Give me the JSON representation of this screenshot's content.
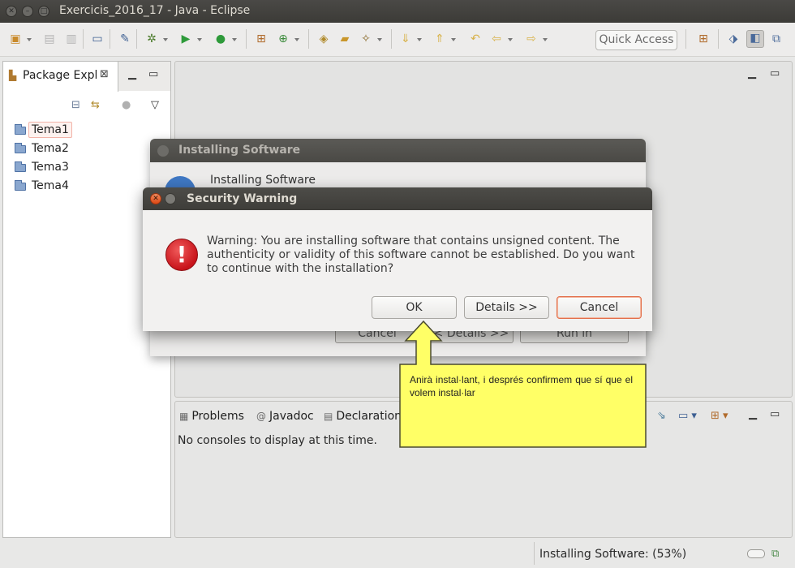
{
  "window": {
    "title": "Exercicis_2016_17 - Java - Eclipse",
    "buttons": [
      "close-icon",
      "minimize-icon",
      "maximize-icon"
    ]
  },
  "toolbar": {
    "quick_access": "Quick Access"
  },
  "package_explorer": {
    "tab_label": "Package Expl",
    "close_glyph": "⊠",
    "items": [
      {
        "label": "Tema1",
        "selected": true
      },
      {
        "label": "Tema2",
        "selected": false
      },
      {
        "label": "Tema3",
        "selected": false
      },
      {
        "label": "Tema4",
        "selected": false
      }
    ]
  },
  "console": {
    "tabs": [
      {
        "label": "Problems",
        "icon": "problems-icon"
      },
      {
        "label": "Javadoc",
        "icon": "at-icon"
      },
      {
        "label": "Declaration",
        "icon": "declaration-icon"
      }
    ],
    "message": "No consoles to display at this time."
  },
  "status_bar": {
    "text": "Installing Software: (53%)",
    "progress": 0.53
  },
  "installing_dialog": {
    "title": "Installing Software",
    "heading": "Installing Software",
    "buttons": [
      "Cancel",
      "< Details >>",
      "Run in Background"
    ]
  },
  "security_dialog": {
    "title": "Security Warning",
    "message": "Warning: You are installing software that contains unsigned content. The authenticity or validity of this software cannot be established. Do you want to continue with the installation?",
    "buttons": {
      "ok": "OK",
      "details": "Details >>",
      "cancel": "Cancel"
    }
  },
  "annotation": {
    "text": "Anirà instal·lant, i després confirmem que sí que el volem instal·lar",
    "color": "#ffff66"
  }
}
